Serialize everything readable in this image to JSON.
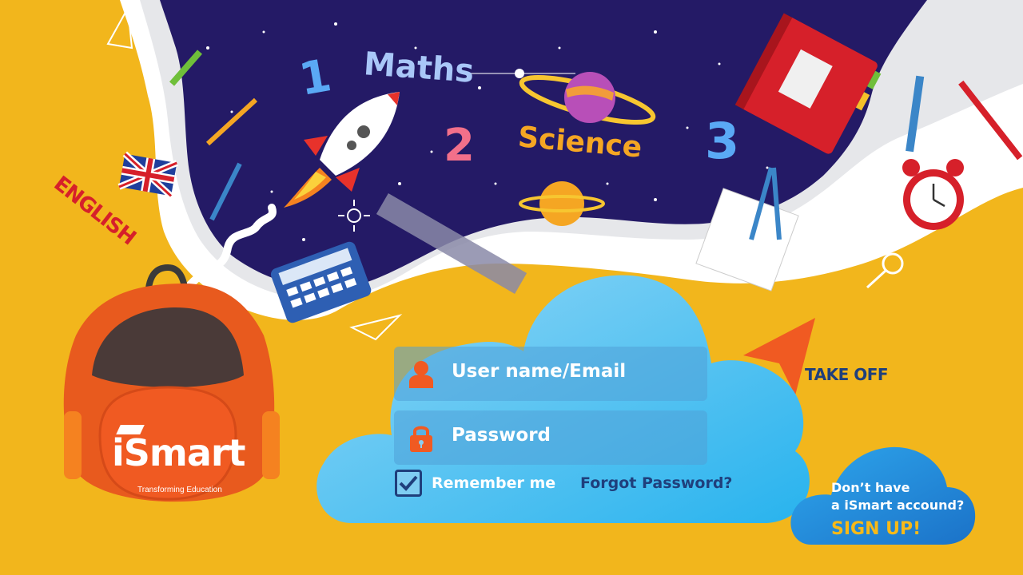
{
  "login": {
    "username_placeholder": "User name/Email",
    "password_placeholder": "Password",
    "remember_label": "Remember me",
    "remember_checked": true,
    "forgot_label": "Forgot Password?",
    "takeoff_label": "TAKE OFF"
  },
  "signup": {
    "question_line1": "Don’t have",
    "question_line2": "a iSmart accound?",
    "link_label": "SIGN UP!"
  },
  "brand": {
    "name": "iSmart",
    "tagline": "Transforming Education"
  },
  "decor": {
    "subjects": [
      "Maths",
      "Science",
      "ENGLISH"
    ],
    "numbers": [
      "1",
      "2",
      "3"
    ]
  },
  "colors": {
    "background": "#f2b61c",
    "space": "#241a66",
    "cloud": "#5fc1f0",
    "accent_orange": "#f05a22",
    "navy_text": "#1f3f7c"
  },
  "icons": [
    "user-icon",
    "lock-icon",
    "checkbox-icon",
    "paper-plane-icon",
    "rocket-icon",
    "planet-icon",
    "calculator-icon",
    "ruler-icon",
    "book-icon",
    "alarm-clock-icon",
    "backpack-icon"
  ]
}
